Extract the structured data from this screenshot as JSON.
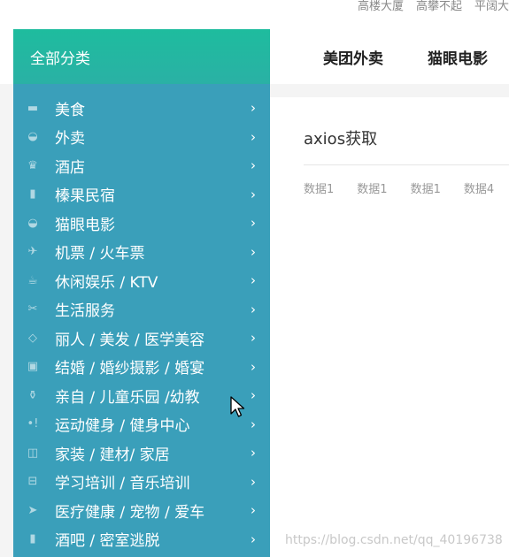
{
  "top_links": [
    "高楼大厦",
    "高攀不起",
    "平阔大"
  ],
  "sidebar": {
    "title": "全部分类",
    "items": [
      {
        "label": "美食",
        "icon": "burger-icon"
      },
      {
        "label": "外卖",
        "icon": "basket-icon"
      },
      {
        "label": "酒店",
        "icon": "crown-icon"
      },
      {
        "label": "榛果民宿",
        "icon": "building-icon"
      },
      {
        "label": "猫眼电影",
        "icon": "basket-icon"
      },
      {
        "label": "机票 / 火车票",
        "icon": "plane-icon"
      },
      {
        "label": "休闲娱乐 / KTV",
        "icon": "cup-icon"
      },
      {
        "label": "生活服务",
        "icon": "tools-icon"
      },
      {
        "label": "丽人 / 美发 / 医学美容",
        "icon": "diamond-icon"
      },
      {
        "label": "结婚 / 婚纱摄影 / 婚宴",
        "icon": "gift-icon"
      },
      {
        "label": "亲自 / 儿童乐园 /幼教",
        "icon": "bottle-icon"
      },
      {
        "label": "运动健身 / 健身中心",
        "icon": "dumbbell-icon"
      },
      {
        "label": "家装 / 建材/ 家居",
        "icon": "wardrobe-icon"
      },
      {
        "label": "学习培训 / 音乐培训",
        "icon": "book-icon"
      },
      {
        "label": "医疗健康 / 宠物 / 爱车",
        "icon": "fish-icon"
      },
      {
        "label": "酒吧 / 密室逃脱",
        "icon": "building-icon"
      }
    ],
    "chevron": "›"
  },
  "topnav": [
    "美团外卖",
    "猫眼电影"
  ],
  "content": {
    "title": "axios获取",
    "data_items": [
      "数据1",
      "数据1",
      "数据1",
      "数据4"
    ]
  },
  "watermark": "https://blog.csdn.net/qq_40196738"
}
